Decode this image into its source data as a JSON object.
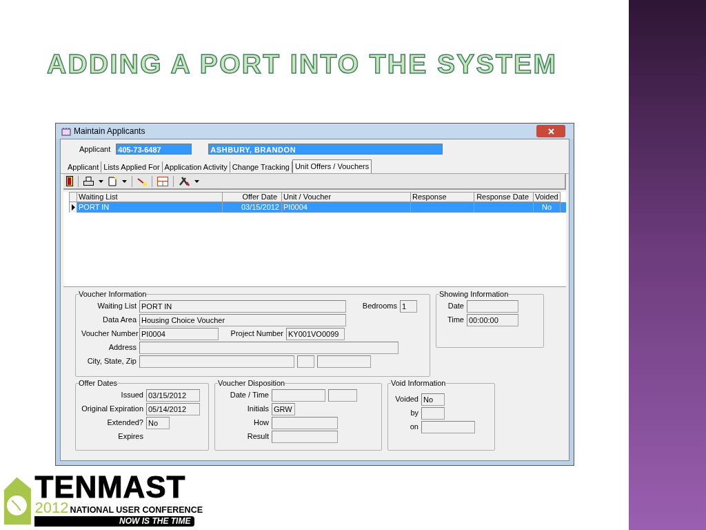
{
  "slide_title": "ADDING A PORT INTO THE SYSTEM",
  "window": {
    "title": "Maintain Applicants",
    "applicant": {
      "label": "Applicant",
      "id": "405-73-6487",
      "name": "ASHBURY, BRANDON"
    },
    "tabs": [
      {
        "label": "Applicant",
        "selected": false
      },
      {
        "label": "Lists Applied For",
        "selected": false
      },
      {
        "label": "Application Activity",
        "selected": false
      },
      {
        "label": "Change Tracking",
        "selected": false
      },
      {
        "label": "Unit Offers / Vouchers",
        "selected": true
      }
    ],
    "table": {
      "columns": [
        "Waiting List",
        "Offer Date",
        "Unit / Voucher",
        "Response",
        "Response Date",
        "Voided"
      ],
      "rows": [
        {
          "cells": [
            {
              "kind": "text",
              "text": "PORT IN"
            },
            {
              "kind": "text",
              "text": "03/15/2012"
            },
            {
              "kind": "text",
              "text": "PI0004"
            },
            {
              "kind": "blank"
            },
            {
              "kind": "blank"
            },
            {
              "kind": "text",
              "text": "No"
            }
          ],
          "selected": true
        }
      ]
    },
    "voucher_information": {
      "title": "Voucher Information",
      "rows": [
        {
          "label": "Waiting List",
          "fields": [
            {
              "kind": "box",
              "value": "PORT IN"
            }
          ],
          "extra": {
            "label": "Bedrooms",
            "fields": [
              {
                "kind": "box",
                "value": "1"
              }
            ]
          }
        },
        {
          "label": "Data Area",
          "fields": [
            {
              "kind": "box",
              "value": "Housing Choice Voucher"
            }
          ]
        },
        {
          "label": "Voucher Number",
          "fields": [
            {
              "kind": "box",
              "value": "PI0004"
            }
          ],
          "extra": {
            "label": "Project Number",
            "fields": [
              {
                "kind": "box",
                "value": "KY001VO0099"
              }
            ]
          }
        },
        {
          "label": "Address",
          "fields": [
            {
              "kind": "box"
            }
          ]
        },
        {
          "label": "City, State, Zip",
          "fields": [
            {
              "kind": "box"
            },
            {
              "kind": "box"
            },
            {
              "kind": "box"
            }
          ]
        }
      ]
    },
    "showing_information": {
      "title": "Showing Information",
      "rows": [
        {
          "label": "Date",
          "fields": [
            {
              "kind": "box"
            }
          ]
        },
        {
          "label": "Time",
          "fields": [
            {
              "kind": "box",
              "value": "00:00:00"
            }
          ]
        }
      ]
    },
    "offer_dates": {
      "title": "Offer Dates",
      "rows": [
        {
          "label": "Issued",
          "fields": [
            {
              "kind": "box",
              "value": "03/15/2012"
            }
          ]
        },
        {
          "label": "Original Expiration",
          "fields": [
            {
              "kind": "box",
              "value": "05/14/2012"
            }
          ]
        },
        {
          "label": "Extended?",
          "fields": [
            {
              "kind": "box",
              "value": "No"
            }
          ]
        },
        {
          "label": "Expires"
        }
      ]
    },
    "voucher_disposition": {
      "title": "Voucher Disposition",
      "rows": [
        {
          "label": "Date / Time",
          "fields": [
            {
              "kind": "box"
            },
            {
              "kind": "box"
            }
          ]
        },
        {
          "label": "Initials",
          "fields": [
            {
              "kind": "box",
              "value": "GRW"
            }
          ]
        },
        {
          "label": "How",
          "fields": [
            {
              "kind": "box"
            }
          ]
        },
        {
          "label": "Result",
          "fields": [
            {
              "kind": "box"
            }
          ]
        }
      ]
    },
    "void_information": {
      "title": "Void Information",
      "rows": [
        {
          "label": "Voided",
          "fields": [
            {
              "kind": "box",
              "value": "No"
            }
          ]
        },
        {
          "label": "by",
          "fields": [
            {
              "kind": "box"
            }
          ]
        },
        {
          "label": "on",
          "fields": [
            {
              "kind": "box"
            }
          ]
        }
      ]
    }
  },
  "logo": {
    "brand": "TENMAST",
    "year": "2012",
    "subtitle": "NATIONAL USER CONFERENCE",
    "tagline": "NOW IS THE TIME"
  }
}
